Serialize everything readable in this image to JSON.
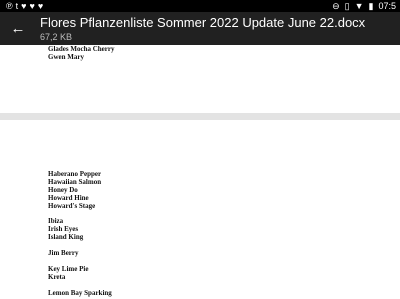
{
  "status_bar": {
    "left_icons": [
      "pinterest-icon",
      "tumblr-icon",
      "twitter-icon",
      "twitter-icon",
      "twitter-icon"
    ],
    "time": "07:5"
  },
  "app_bar": {
    "title": "Flores Pflanzenliste Sommer 2022 Update June 22.docx",
    "file_size": "67,2 KB"
  },
  "document": {
    "page1_entries": [
      "Glades Mocha Cherry",
      "Gwen Mary"
    ],
    "page2_groups": [
      [
        "Haberano Pepper",
        "Hawaiian Salmon",
        "Honey Do",
        "Howard Hine",
        "Howard's Stage"
      ],
      [
        "Ibiza",
        "Irish Eyes",
        "Island King"
      ],
      [
        "Jim Berry"
      ],
      [
        "Key Lime Pie",
        "Kreta"
      ],
      [
        "Lemon Bay Sparking"
      ]
    ]
  }
}
